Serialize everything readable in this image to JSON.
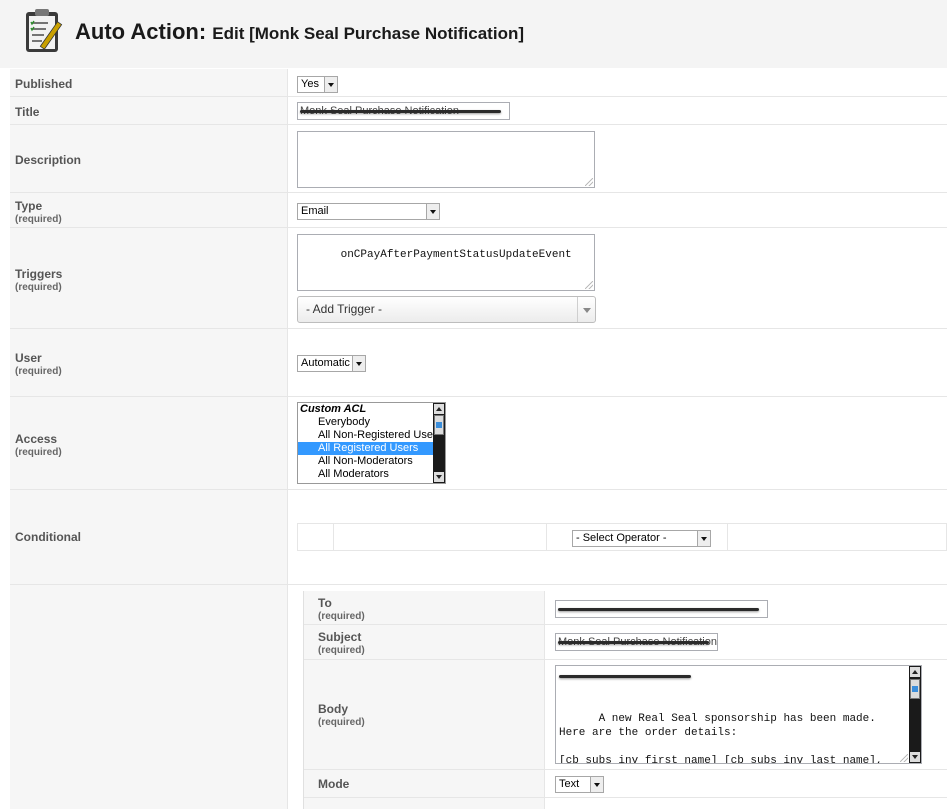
{
  "header": {
    "title": "Auto Action:",
    "subtitle": "Edit [Monk Seal Purchase Notification]",
    "icon": "clipboard-edit-icon"
  },
  "required_label": "(required)",
  "fields": {
    "published": {
      "label": "Published",
      "value": "Yes"
    },
    "title": {
      "label": "Title",
      "value": "Monk Seal Purchase Notification"
    },
    "description": {
      "label": "Description",
      "value": ""
    },
    "type": {
      "label": "Type",
      "value": "Email"
    },
    "triggers": {
      "label": "Triggers",
      "value": "onCPayAfterPaymentStatusUpdateEvent",
      "add_placeholder": "- Add Trigger -"
    },
    "user": {
      "label": "User",
      "value": "Automatic"
    },
    "access": {
      "label": "Access",
      "group": "Custom ACL",
      "options": [
        "Everybody",
        "All Non-Registered Users",
        "All Registered Users",
        "All Non-Moderators",
        "All Moderators"
      ],
      "selected": "All Registered Users"
    },
    "conditional": {
      "label": "Conditional",
      "operator_placeholder": "- Select Operator -"
    }
  },
  "email": {
    "to": {
      "label": "To",
      "value": ""
    },
    "subject": {
      "label": "Subject",
      "value": "Monk Seal Purchase Notification"
    },
    "body": {
      "label": "Body",
      "value": "A new Real Seal sponsorship has been made. Here are the order details:\n\n[cb_subs_inv_first_name] [cb_subs_inv_last_name],\n[cb_subs_inv_address_street]"
    },
    "mode": {
      "label": "Mode",
      "value": "Text"
    }
  },
  "colors": {
    "header_bg": "#f4f4f4",
    "label_bg": "#f6f6f6",
    "selection": "#3399ff"
  }
}
